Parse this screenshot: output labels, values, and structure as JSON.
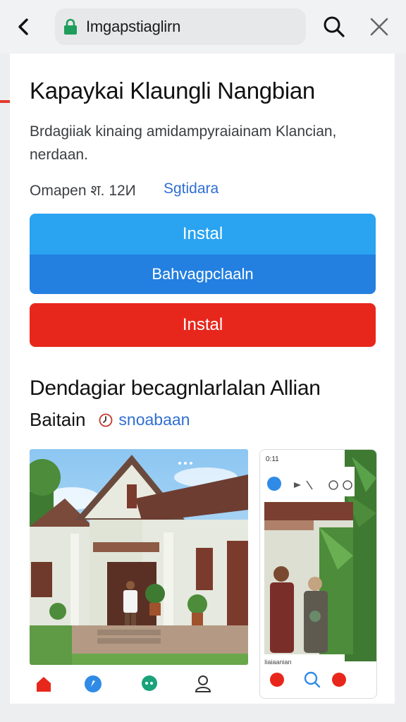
{
  "browser": {
    "url": "Imgapstiaglirn",
    "icons": {
      "back": "chevron-left-icon",
      "lock": "lock-icon",
      "search": "search-icon",
      "close": "close-icon"
    }
  },
  "app": {
    "title": "Kapaykai Klaungli Nangbian",
    "description": "Brdagiiak kinaing amidampyraiainam Klancian, nerdaan.",
    "meta_label": "Omapen श. 12И",
    "meta_link": "Sgtidara"
  },
  "buttons": {
    "install_primary": "Instal",
    "secondary": "Bahvagpclaaln",
    "install_red": "Instal"
  },
  "colors": {
    "install_primary": "#2aa3f1",
    "secondary": "#237fe0",
    "install_red": "#e8271c",
    "link": "#2f6fd1"
  },
  "section": {
    "title": "Dendagiar becagnlarlalan Allian",
    "subtitle": "Baitain",
    "link": "snoabaan"
  },
  "screenshots": {
    "side": {
      "time": "0:11",
      "caption": "Iiaiaanian"
    }
  },
  "bottom_nav": [
    {
      "icon": "home-icon",
      "color": "#e8271c"
    },
    {
      "icon": "compass-icon",
      "color": "#2f8be6"
    },
    {
      "icon": "chat-icon",
      "color": "#1aa37a"
    },
    {
      "icon": "profile-icon",
      "color": "#333333"
    }
  ]
}
